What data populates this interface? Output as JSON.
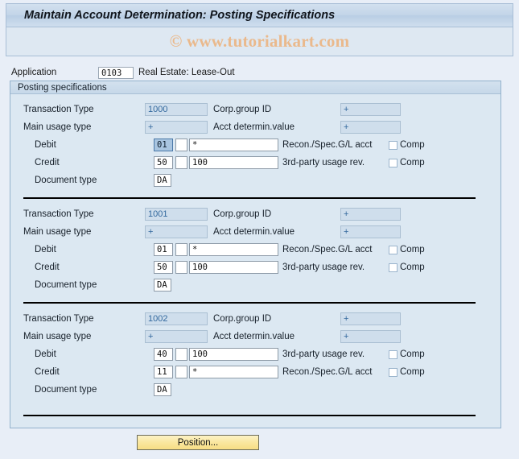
{
  "window": {
    "title": "Maintain Account Determination: Posting Specifications",
    "watermark": "© www.tutorialkart.com"
  },
  "application": {
    "label": "Application",
    "value": "0103",
    "description": "Real Estate: Lease-Out"
  },
  "panel": {
    "header": "Posting specifications"
  },
  "labels": {
    "transaction_type": "Transaction Type",
    "corp_group_id": "Corp.group ID",
    "main_usage_type": "Main usage type",
    "acct_determin_value": "Acct determin.value",
    "debit": "Debit",
    "credit": "Credit",
    "document_type": "Document type",
    "comp": "Comp"
  },
  "blocks": [
    {
      "transaction_type": "1000",
      "corp_group_id": "+",
      "main_usage_type": "+",
      "acct_determin_value": "+",
      "debit": {
        "posting_key": "01",
        "indicator": "",
        "account": "*",
        "description": "Recon./Spec.G/L acct",
        "comp_checked": false,
        "focused": true
      },
      "credit": {
        "posting_key": "50",
        "indicator": "",
        "account": "100",
        "description": "3rd-party usage rev.",
        "comp_checked": false,
        "focused": false
      },
      "document_type": "DA"
    },
    {
      "transaction_type": "1001",
      "corp_group_id": "+",
      "main_usage_type": "+",
      "acct_determin_value": "+",
      "debit": {
        "posting_key": "01",
        "indicator": "",
        "account": "*",
        "description": "Recon./Spec.G/L acct",
        "comp_checked": false,
        "focused": false
      },
      "credit": {
        "posting_key": "50",
        "indicator": "",
        "account": "100",
        "description": "3rd-party usage rev.",
        "comp_checked": false,
        "focused": false
      },
      "document_type": "DA"
    },
    {
      "transaction_type": "1002",
      "corp_group_id": "+",
      "main_usage_type": "+",
      "acct_determin_value": "+",
      "debit": {
        "posting_key": "40",
        "indicator": "",
        "account": "100",
        "description": "3rd-party usage rev.",
        "comp_checked": false,
        "focused": false
      },
      "credit": {
        "posting_key": "11",
        "indicator": "",
        "account": "*",
        "description": "Recon./Spec.G/L acct",
        "comp_checked": false,
        "focused": false
      },
      "document_type": "DA"
    }
  ],
  "footer": {
    "position_button": "Position..."
  },
  "colors": {
    "page_background": "#e8eef7",
    "panel_background": "#dce8f2",
    "titlebar": "#c3d5e8",
    "watermark": "#eab98c",
    "readonly_field": "#cfdeec",
    "readonly_text": "#33699e",
    "focused_field": "#a9c5e0",
    "button_yellow": "#fae79f"
  }
}
